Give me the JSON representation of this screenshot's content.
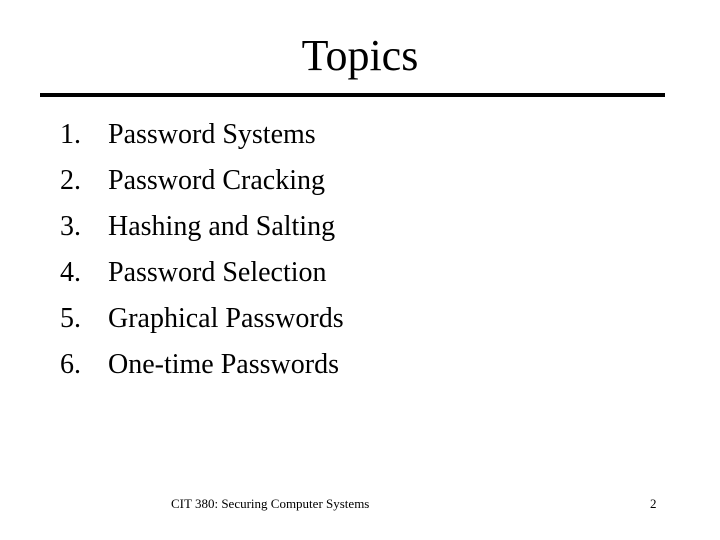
{
  "slide": {
    "title": "Topics",
    "items": [
      {
        "number": "1.",
        "label": "Password Systems"
      },
      {
        "number": "2.",
        "label": "Password Cracking"
      },
      {
        "number": "3.",
        "label": "Hashing and Salting"
      },
      {
        "number": "4.",
        "label": "Password Selection"
      },
      {
        "number": "5.",
        "label": "Graphical Passwords"
      },
      {
        "number": "6.",
        "label": "One-time Passwords"
      }
    ],
    "footer": "CIT 380: Securing Computer Systems",
    "page_number": "2"
  }
}
